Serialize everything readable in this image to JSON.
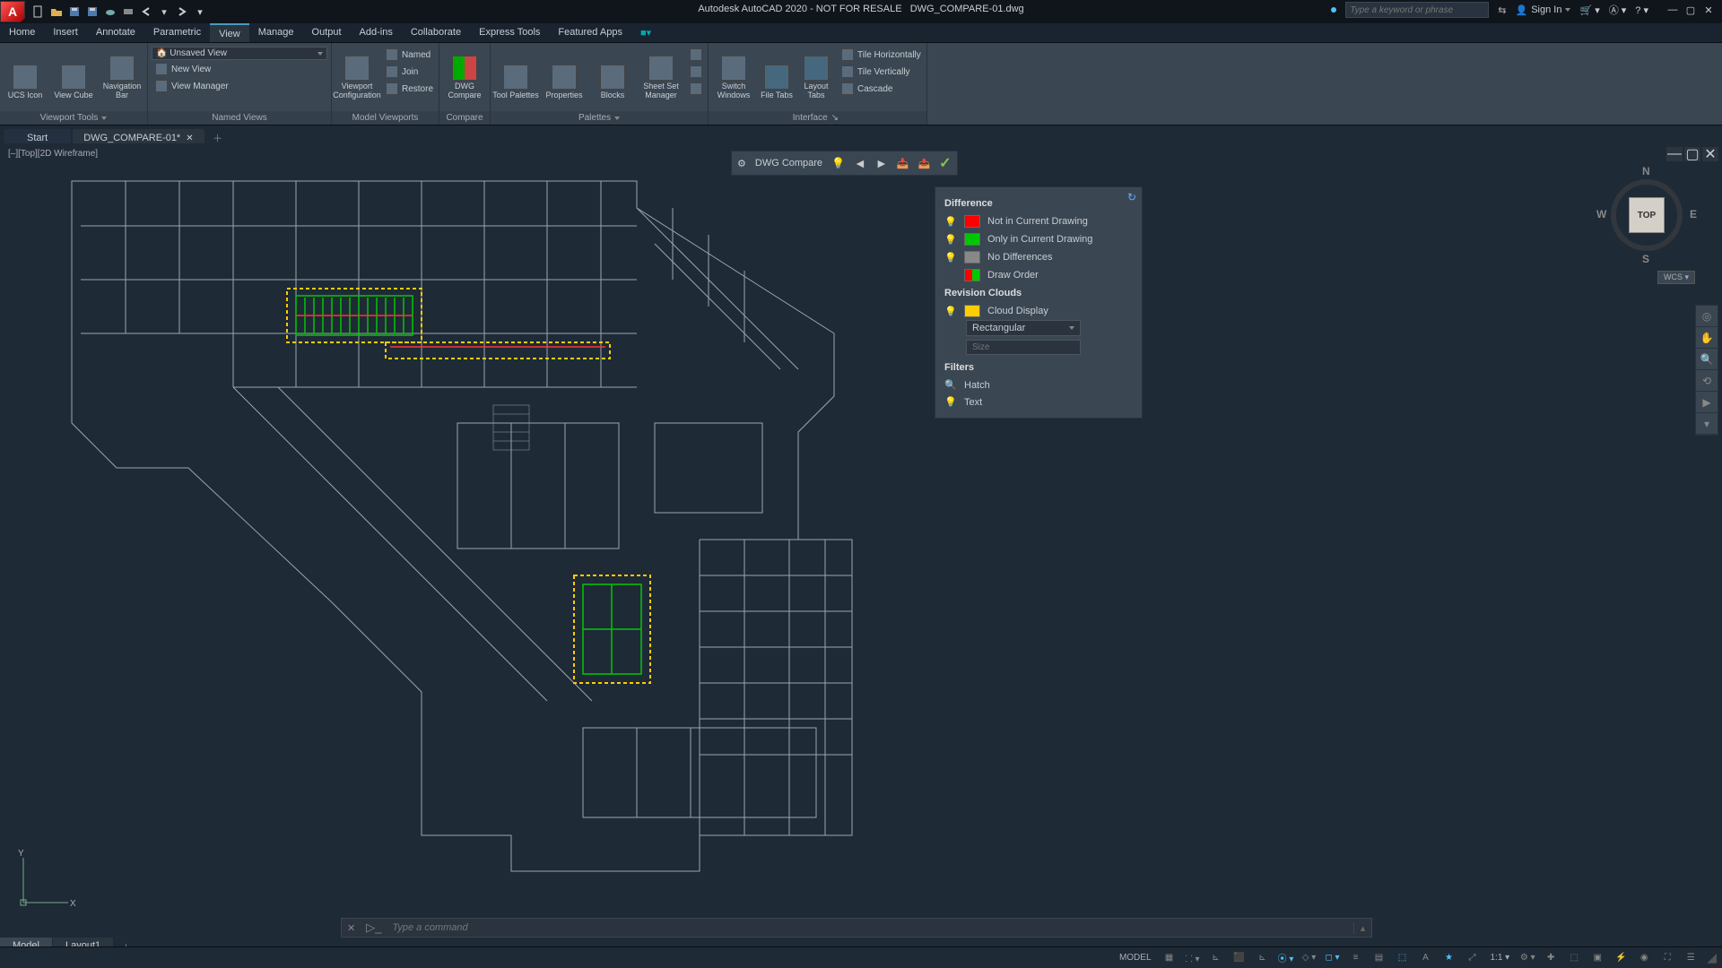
{
  "titlebar": {
    "app_title": "Autodesk AutoCAD 2020 - NOT FOR RESALE",
    "filename": "DWG_COMPARE-01.dwg",
    "search_placeholder": "Type a keyword or phrase",
    "signin": "Sign In"
  },
  "menubar": {
    "items": [
      "Home",
      "Insert",
      "Annotate",
      "Parametric",
      "View",
      "Manage",
      "Output",
      "Add-ins",
      "Collaborate",
      "Express Tools",
      "Featured Apps"
    ],
    "active": "View"
  },
  "ribbon": {
    "viewport_tools": {
      "ucs": "UCS Icon",
      "viewcube": "View Cube",
      "navbar": "Navigation Bar",
      "label": "Viewport Tools"
    },
    "named_views": {
      "unsaved": "Unsaved View",
      "named": "Named",
      "newview": "New View",
      "join": "Join",
      "viewmgr": "View Manager",
      "viewport_cfg": "Viewport Configuration",
      "restore": "Restore",
      "label": "Named Views",
      "label2": "Model Viewports"
    },
    "compare": {
      "dwg_compare": "DWG Compare",
      "label": "Compare"
    },
    "palettes": {
      "tool": "Tool Palettes",
      "properties": "Properties",
      "blocks": "Blocks",
      "sheetset": "Sheet Set Manager",
      "label": "Palettes"
    },
    "interface": {
      "switch_windows": "Switch Windows",
      "filetabs": "File Tabs",
      "layouttabs": "Layout Tabs",
      "tile_h": "Tile Horizontally",
      "tile_v": "Tile Vertically",
      "cascade": "Cascade",
      "label": "Interface"
    }
  },
  "filetabs": {
    "start": "Start",
    "file1": "DWG_COMPARE-01*"
  },
  "viewport_label": "[–][Top][2D Wireframe]",
  "compare_toolbar": {
    "title": "DWG Compare"
  },
  "diff_panel": {
    "difference": "Difference",
    "not_in_current": "Not in Current Drawing",
    "only_in_current": "Only in Current Drawing",
    "no_diff": "No Differences",
    "draw_order": "Draw Order",
    "revision_clouds": "Revision Clouds",
    "cloud_display": "Cloud Display",
    "cloud_shape": "Rectangular",
    "size_placeholder": "Size",
    "filters": "Filters",
    "hatch": "Hatch",
    "text": "Text"
  },
  "viewcube": {
    "face": "TOP",
    "n": "N",
    "s": "S",
    "e": "E",
    "w": "W",
    "wcs": "WCS"
  },
  "command": {
    "placeholder": "Type a command"
  },
  "bottom_tabs": {
    "model": "Model",
    "layout1": "Layout1"
  },
  "status": {
    "model": "MODEL",
    "scale": "1:1"
  },
  "colors": {
    "diff_red": "#ff0000",
    "diff_green": "#00c800",
    "diff_yellow": "#ffcc00",
    "bg": "#1e2a36"
  }
}
